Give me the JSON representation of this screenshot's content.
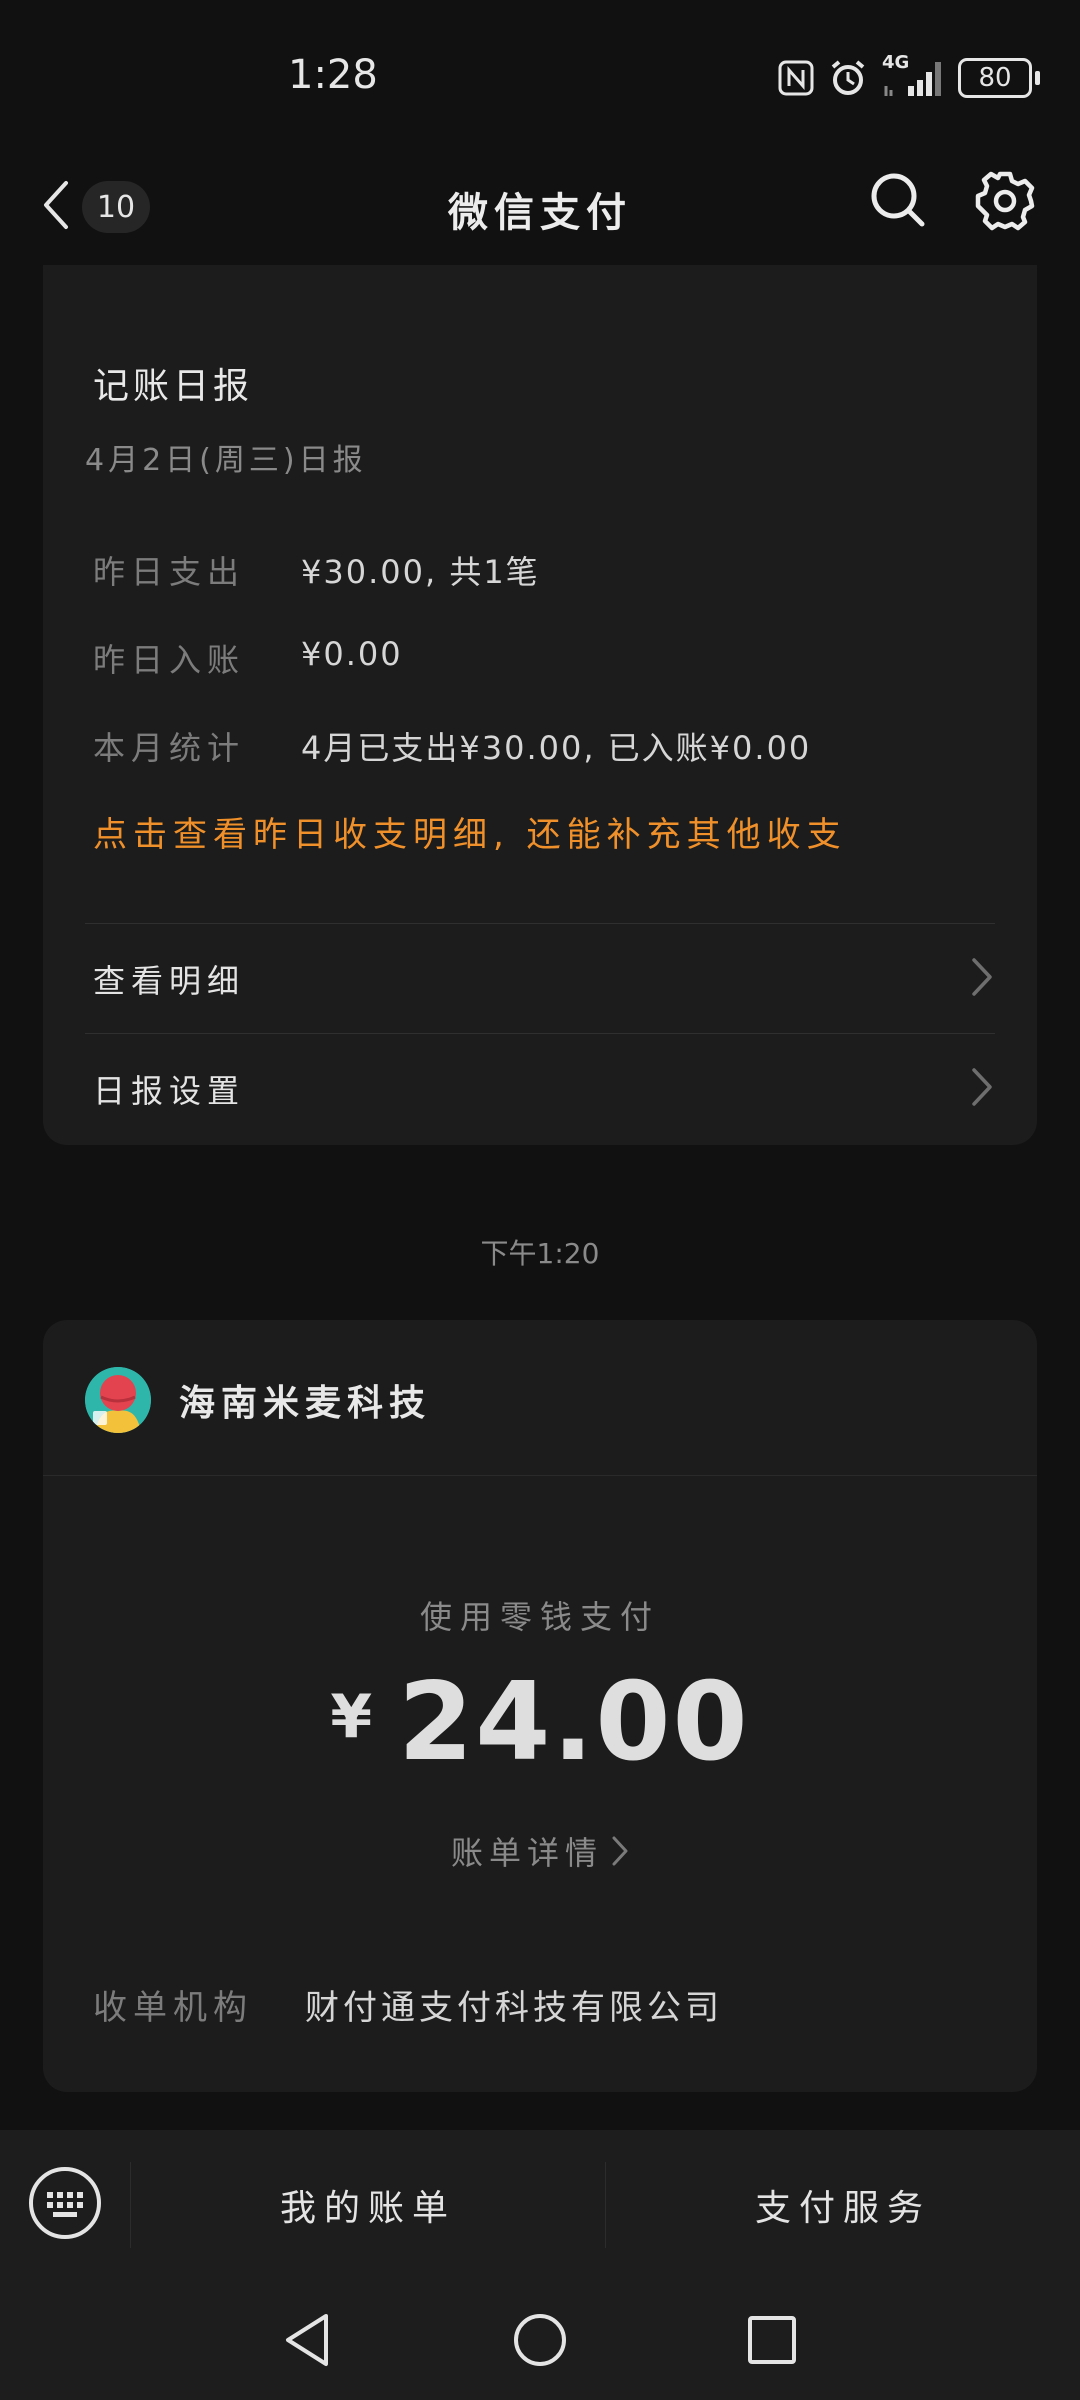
{
  "status": {
    "time": "1:28",
    "network": "4G",
    "battery": "80"
  },
  "nav": {
    "back_count": "10",
    "title": "微信支付"
  },
  "report": {
    "title": "记账日报",
    "date": "4月2日(周三)日报",
    "rows": [
      {
        "label": "昨日支出",
        "value": "¥30.00, 共1笔"
      },
      {
        "label": "昨日入账",
        "value": "¥0.00"
      },
      {
        "label": "本月统计",
        "value": "4月已支出¥30.00, 已入账¥0.00"
      }
    ],
    "link": "点击查看昨日收支明细, 还能补充其他收支",
    "menu": [
      {
        "label": "查看明细"
      },
      {
        "label": "日报设置"
      }
    ]
  },
  "timestamp": "下午1:20",
  "payment": {
    "merchant": "海南米麦科技",
    "method": "使用零钱支付",
    "currency": "¥",
    "amount": "24.00",
    "detail_link": "账单详情",
    "acquirer_label": "收单机构",
    "acquirer_value": "财付通支付科技有限公司"
  },
  "bottom": {
    "my_bills": "我的账单",
    "pay_service": "支付服务"
  },
  "colors": {
    "accent": "#f0902a",
    "background": "#111111",
    "card": "#1c1c1c"
  }
}
